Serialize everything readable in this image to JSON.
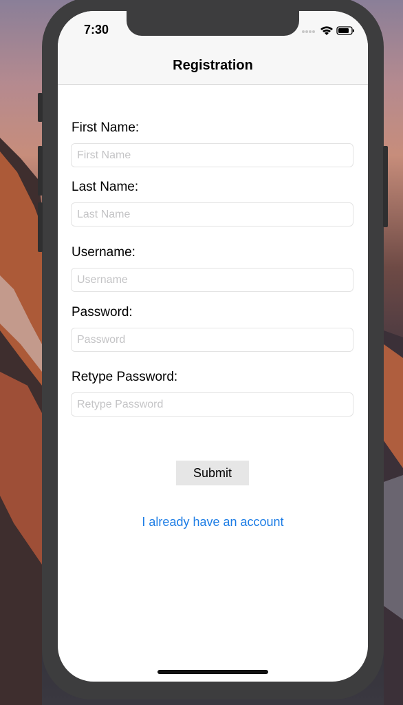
{
  "status_bar": {
    "time": "7:30"
  },
  "navbar": {
    "title": "Registration"
  },
  "form": {
    "fields": [
      {
        "label": "First Name:",
        "placeholder": "First Name",
        "value": ""
      },
      {
        "label": "Last Name:",
        "placeholder": "Last Name",
        "value": ""
      },
      {
        "label": "Username:",
        "placeholder": "Username",
        "value": ""
      },
      {
        "label": "Password:",
        "placeholder": "Password",
        "value": ""
      },
      {
        "label": "Retype Password:",
        "placeholder": "Retype Password",
        "value": ""
      }
    ],
    "submit_label": "Submit",
    "login_link": "I already have an account"
  },
  "colors": {
    "link": "#1b7ce5",
    "button_bg": "#e6e6e6",
    "navbar_bg": "#f7f7f7"
  },
  "icons": {
    "signal": "signal-dots-icon",
    "wifi": "wifi-icon",
    "battery": "battery-icon"
  }
}
